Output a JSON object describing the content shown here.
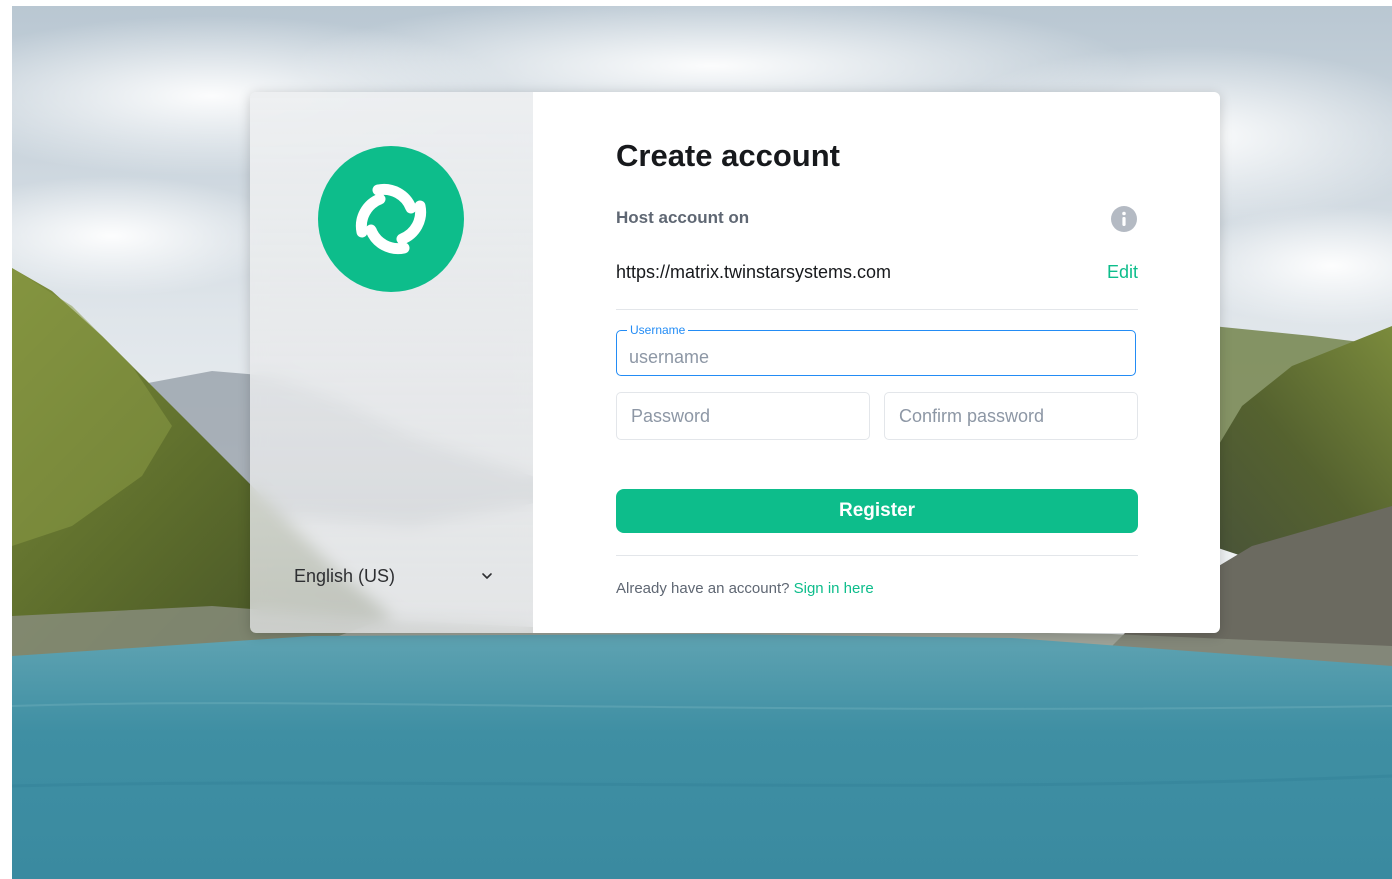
{
  "page": {
    "title": "Create account"
  },
  "host": {
    "label": "Host account on",
    "url": "https://matrix.twinstarsystems.com",
    "edit_label": "Edit"
  },
  "form": {
    "username_label": "Username",
    "username_placeholder": "username",
    "password_placeholder": "Password",
    "confirm_password_placeholder": "Confirm password",
    "register_label": "Register"
  },
  "footer": {
    "signin_prompt": "Already have an account?",
    "signin_link": "Sign in here"
  },
  "language": {
    "selected": "English (US)"
  },
  "icons": {
    "logo": "element-logo-icon",
    "info": "info-icon",
    "chevron": "chevron-down-icon"
  },
  "colors": {
    "accent": "#0dbd8b",
    "focus": "#238cf5",
    "text_primary": "#17191c",
    "text_secondary": "#5f6773"
  }
}
